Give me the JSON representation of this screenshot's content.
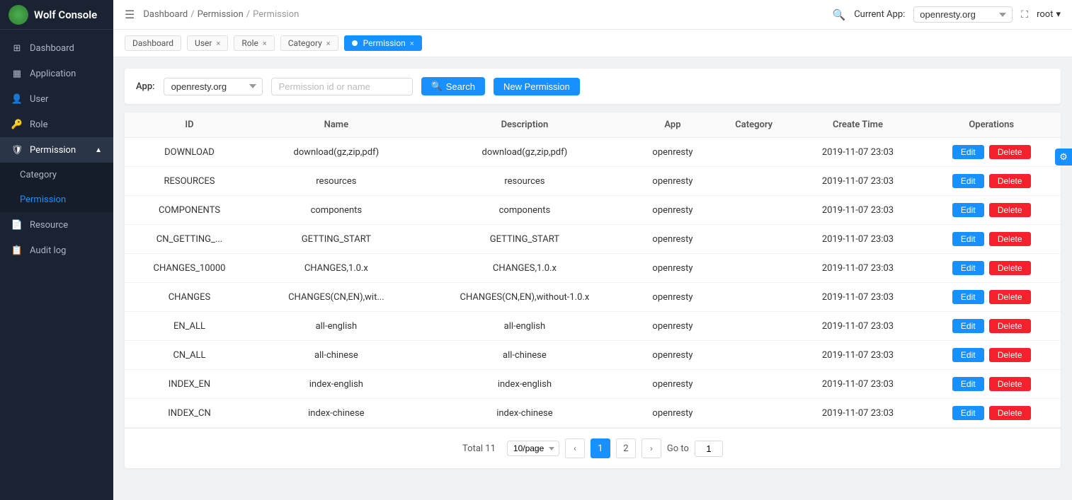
{
  "app": {
    "title": "Wolf Console",
    "logo_color": "#4caf50"
  },
  "sidebar": {
    "hamburger": "☰",
    "items": [
      {
        "id": "dashboard",
        "label": "Dashboard",
        "icon": "⊞",
        "active": false
      },
      {
        "id": "application",
        "label": "Application",
        "icon": "⊡",
        "active": false
      },
      {
        "id": "user",
        "label": "User",
        "icon": "👤",
        "active": false
      },
      {
        "id": "role",
        "label": "Role",
        "icon": "🔑",
        "active": false
      },
      {
        "id": "permission",
        "label": "Permission",
        "icon": "🛡",
        "active": true
      },
      {
        "id": "category",
        "label": "Category",
        "active": false,
        "sub": true
      },
      {
        "id": "permission-sub",
        "label": "Permission",
        "active": true,
        "sub": true
      },
      {
        "id": "resource",
        "label": "Resource",
        "icon": "📄",
        "active": false
      },
      {
        "id": "audit-log",
        "label": "Audit log",
        "icon": "📋",
        "active": false
      }
    ]
  },
  "header": {
    "breadcrumb": [
      "Dashboard",
      "Permission",
      "Permission"
    ],
    "search_icon": "🔍",
    "current_app_label": "Current App:",
    "current_app_value": "openresty.org",
    "expand_icon": "⛶",
    "user": "root",
    "user_caret": "▾"
  },
  "tabs": [
    {
      "id": "dashboard",
      "label": "Dashboard",
      "closable": false,
      "active": false
    },
    {
      "id": "user",
      "label": "User",
      "closable": true,
      "active": false
    },
    {
      "id": "role",
      "label": "Role",
      "closable": true,
      "active": false
    },
    {
      "id": "category",
      "label": "Category",
      "closable": true,
      "active": false
    },
    {
      "id": "permission",
      "label": "Permission",
      "closable": true,
      "active": true
    }
  ],
  "filter": {
    "app_label": "App:",
    "app_value": "openresty.org",
    "permission_placeholder": "Permission id or name",
    "search_label": "Search",
    "new_permission_label": "New Permission"
  },
  "table": {
    "columns": [
      "ID",
      "Name",
      "Description",
      "App",
      "Category",
      "Create Time",
      "Operations"
    ],
    "rows": [
      {
        "id": "DOWNLOAD",
        "name": "download(gz,zip,pdf)",
        "description": "download(gz,zip,pdf)",
        "app": "openresty",
        "category": "",
        "create_time": "2019-11-07 23:03"
      },
      {
        "id": "RESOURCES",
        "name": "resources",
        "description": "resources",
        "app": "openresty",
        "category": "",
        "create_time": "2019-11-07 23:03"
      },
      {
        "id": "COMPONENTS",
        "name": "components",
        "description": "components",
        "app": "openresty",
        "category": "",
        "create_time": "2019-11-07 23:03"
      },
      {
        "id": "CN_GETTING_...",
        "name": "GETTING_START",
        "description": "GETTING_START",
        "app": "openresty",
        "category": "",
        "create_time": "2019-11-07 23:03"
      },
      {
        "id": "CHANGES_10000",
        "name": "CHANGES,1.0.x",
        "description": "CHANGES,1.0.x",
        "app": "openresty",
        "category": "",
        "create_time": "2019-11-07 23:03"
      },
      {
        "id": "CHANGES",
        "name": "CHANGES(CN,EN),wit...",
        "description": "CHANGES(CN,EN),without-1.0.x",
        "app": "openresty",
        "category": "",
        "create_time": "2019-11-07 23:03"
      },
      {
        "id": "EN_ALL",
        "name": "all-english",
        "description": "all-english",
        "app": "openresty",
        "category": "",
        "create_time": "2019-11-07 23:03"
      },
      {
        "id": "CN_ALL",
        "name": "all-chinese",
        "description": "all-chinese",
        "app": "openresty",
        "category": "",
        "create_time": "2019-11-07 23:03"
      },
      {
        "id": "INDEX_EN",
        "name": "index-english",
        "description": "index-english",
        "app": "openresty",
        "category": "",
        "create_time": "2019-11-07 23:03"
      },
      {
        "id": "INDEX_CN",
        "name": "index-chinese",
        "description": "index-chinese",
        "app": "openresty",
        "category": "",
        "create_time": "2019-11-07 23:03"
      }
    ],
    "btn_edit": "Edit",
    "btn_delete": "Delete"
  },
  "pagination": {
    "total_label": "Total",
    "total": 11,
    "page_size": "10/page",
    "pages": [
      1,
      2
    ],
    "current_page": 1,
    "goto_label": "Go to",
    "goto_value": "1"
  }
}
